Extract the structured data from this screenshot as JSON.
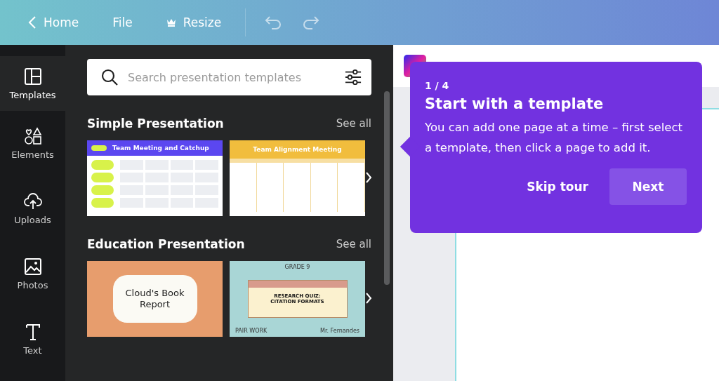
{
  "toolbar": {
    "items": [
      {
        "kind": "back",
        "label": "Home"
      },
      {
        "kind": "plain",
        "label": "File"
      },
      {
        "kind": "crown",
        "label": "Resize"
      }
    ]
  },
  "sidebar": {
    "items": [
      {
        "kind": "templates",
        "label": "Templates",
        "selected": true
      },
      {
        "kind": "elements",
        "label": "Elements",
        "selected": false
      },
      {
        "kind": "uploads",
        "label": "Uploads",
        "selected": false
      },
      {
        "kind": "photos",
        "label": "Photos",
        "selected": false
      },
      {
        "kind": "text",
        "label": "Text",
        "selected": false
      }
    ]
  },
  "search": {
    "placeholder": "Search presentation templates"
  },
  "sections": [
    {
      "title": "Simple Presentation",
      "see_all": "See all",
      "templates": [
        {
          "kind": "meeting",
          "title": "Team Meeting and Catchup"
        },
        {
          "kind": "alignment",
          "title": "Team Alignment Meeting"
        }
      ]
    },
    {
      "title": "Education Presentation",
      "see_all": "See all",
      "templates": [
        {
          "kind": "book",
          "title": "Cloud's Book Report"
        },
        {
          "kind": "quiz",
          "title": "RESEARCH QUIZ: CITATION FORMATS",
          "top": "GRADE 9",
          "left": "PAIR WORK",
          "right": "Mr. Fernandes"
        }
      ]
    }
  ],
  "tour": {
    "step": "1 / 4",
    "title": "Start with a template",
    "body": "You can add one page at a time – first select a template, then click a page to add it.",
    "skip": "Skip tour",
    "next": "Next"
  }
}
